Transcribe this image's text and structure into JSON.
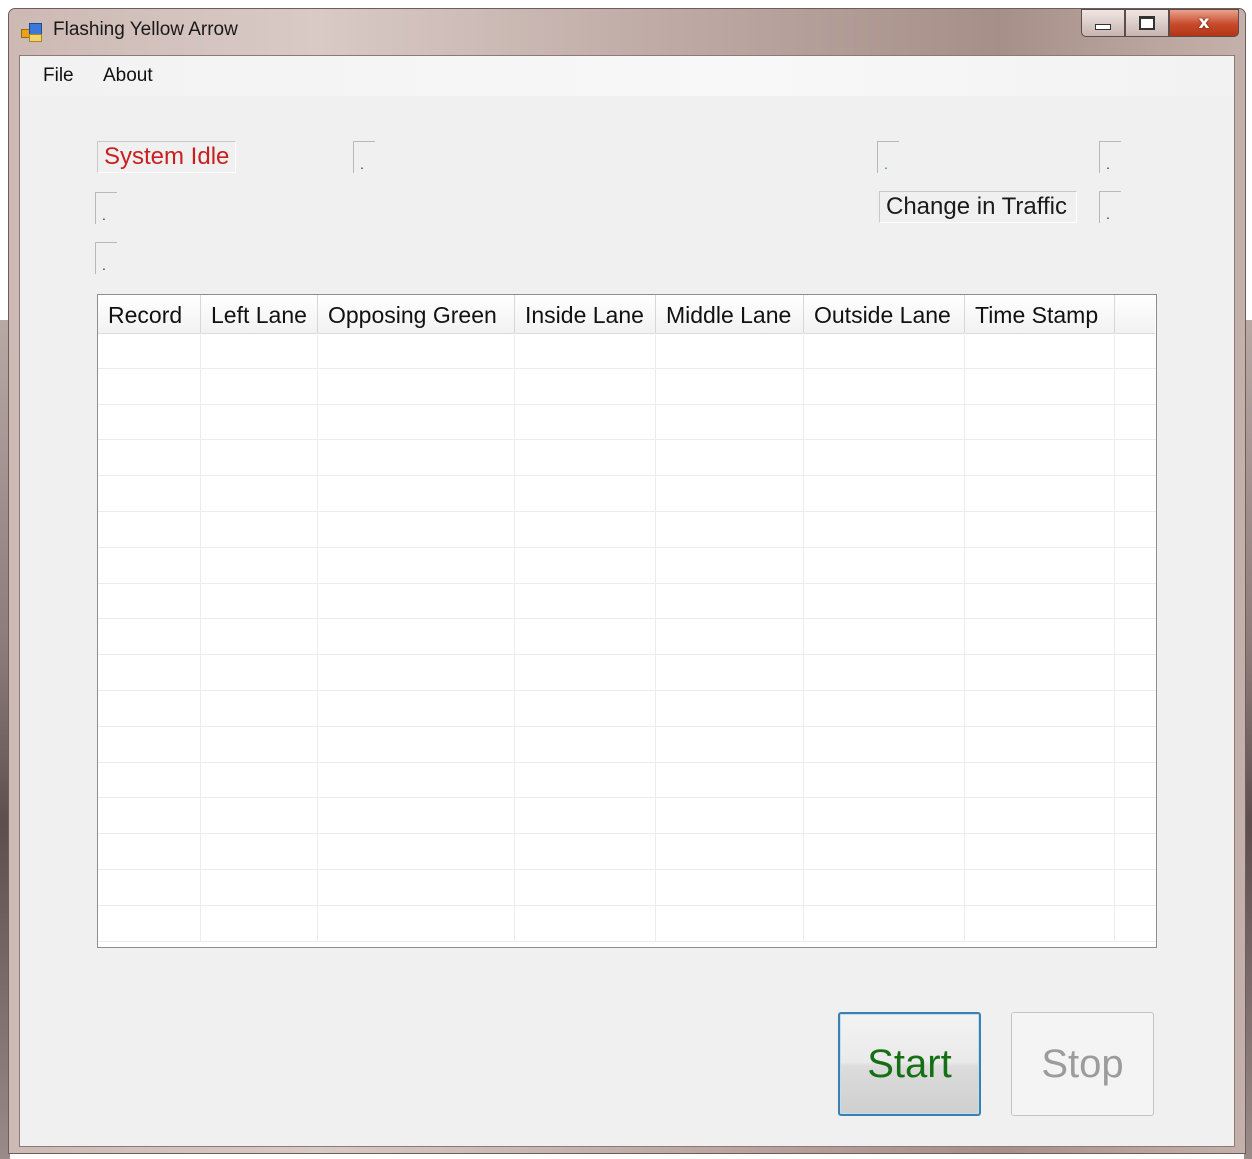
{
  "window": {
    "title": "Flashing Yellow Arrow",
    "minimize_label": "",
    "maximize_label": "",
    "close_label": "x"
  },
  "menu": {
    "items": [
      {
        "label": "File"
      },
      {
        "label": "About"
      }
    ]
  },
  "status": {
    "system_status": "System Idle",
    "traffic_status": "Change in Traffic",
    "indicators": [
      ".",
      ".",
      ".",
      ".",
      ".",
      "."
    ]
  },
  "colors": {
    "status_idle": "#c81f1f",
    "start_text": "#157015",
    "stop_text_disabled": "#9c9c9c",
    "indicator_green": "#2a9a2a"
  },
  "grid": {
    "columns": [
      "Record",
      "Left Lane",
      "Opposing Green",
      "Inside Lane",
      "Middle Lane",
      "Outside Lane",
      "Time Stamp"
    ],
    "rows": []
  },
  "buttons": {
    "start_label": "Start",
    "stop_label": "Stop",
    "stop_enabled": false
  }
}
